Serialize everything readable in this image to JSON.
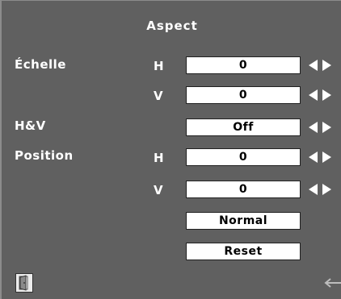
{
  "menu": {
    "title": "Aspect",
    "rows": {
      "scale_label": "Échelle",
      "scale_h_axis": "H",
      "scale_h_value": "0",
      "scale_v_axis": "V",
      "scale_v_value": "0",
      "hv_label": "H&V",
      "hv_value": "Off",
      "position_label": "Position",
      "position_h_axis": "H",
      "position_h_value": "0",
      "position_v_axis": "V",
      "position_v_value": "0",
      "normal_label": "Normal",
      "reset_label": "Reset"
    },
    "icons": {
      "adjust": "left-right-arrows-icon",
      "exit": "exit-door-icon",
      "back": "back-arrow-icon"
    },
    "colors": {
      "background": "#606060",
      "text": "#ffffff",
      "field": "#ffffff",
      "field_text": "#000000"
    }
  }
}
